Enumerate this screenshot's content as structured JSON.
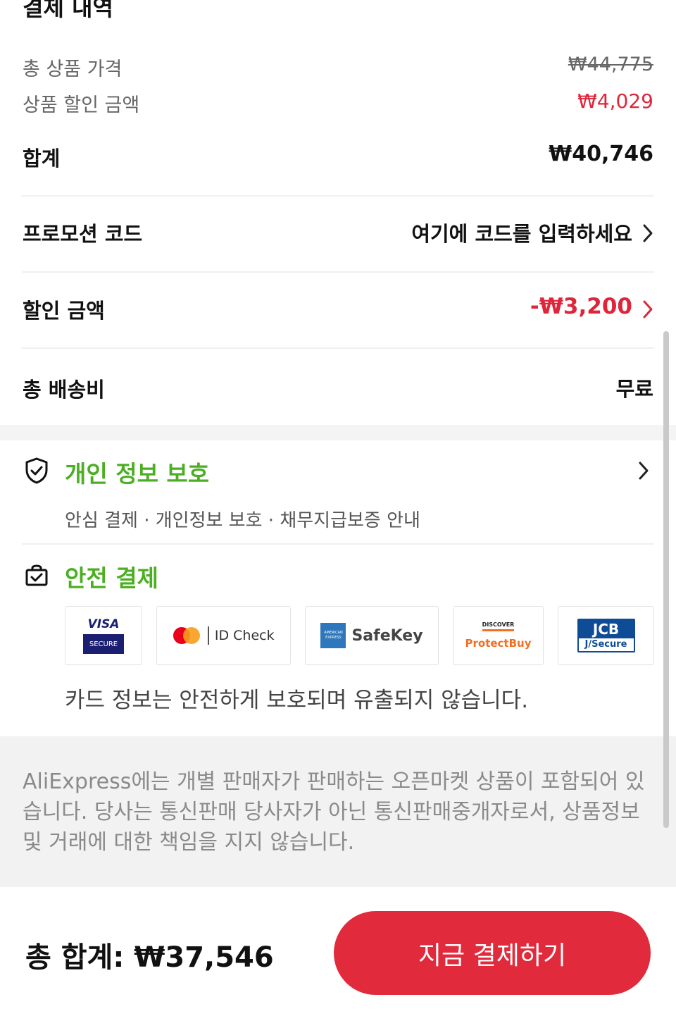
{
  "summary": {
    "title": "결제 내역",
    "total_product_price_label": "총 상품 가격",
    "total_product_price_value": "₩44,775",
    "product_discount_label": "상품 할인 금액",
    "product_discount_value": "₩4,029",
    "subtotal_label": "합계",
    "subtotal_value": "₩40,746",
    "promo_label": "프로모션 코드",
    "promo_placeholder": "여기에 코드를 입력하세요",
    "discount_label": "할인 금액",
    "discount_value": "-₩3,200",
    "shipping_label": "총 배송비",
    "shipping_value": "무료"
  },
  "privacy": {
    "title": "개인 정보 보호",
    "subtitle": "안심 결제 · 개인정보 보호 · 채무지급보증 안내",
    "icon": "shield-check-icon"
  },
  "secure_payment": {
    "title": "안전 결제",
    "icon": "secure-bag-icon",
    "badges": {
      "visa_top": "VISA",
      "visa_bottom": "SECURE",
      "mastercard": "ID Check",
      "amex_small": "AMERICAN EXPRESS",
      "amex": "SafeKey",
      "discover_top": "DISCOVER",
      "discover": "ProtectBuy",
      "jcb_top": "JCB",
      "jcb_bottom": "J/Secure"
    },
    "note": "카드 정보는 안전하게 보호되며 유출되지 않습니다."
  },
  "disclaimer": "AliExpress에는 개별 판매자가 판매하는 오픈마켓 상품이 포함되어 있습니다. 당사는 통신판매 당사자가 아닌 통신판매중개자로서, 상품정보 및 거래에 대한 책임을 지지 않습니다.",
  "footer": {
    "total_label": "총 합계: ₩37,546",
    "pay_button": "지금 결제하기"
  },
  "colors": {
    "accent_red": "#e0253a",
    "green": "#4caf23",
    "pay_button": "#e12a3c"
  }
}
